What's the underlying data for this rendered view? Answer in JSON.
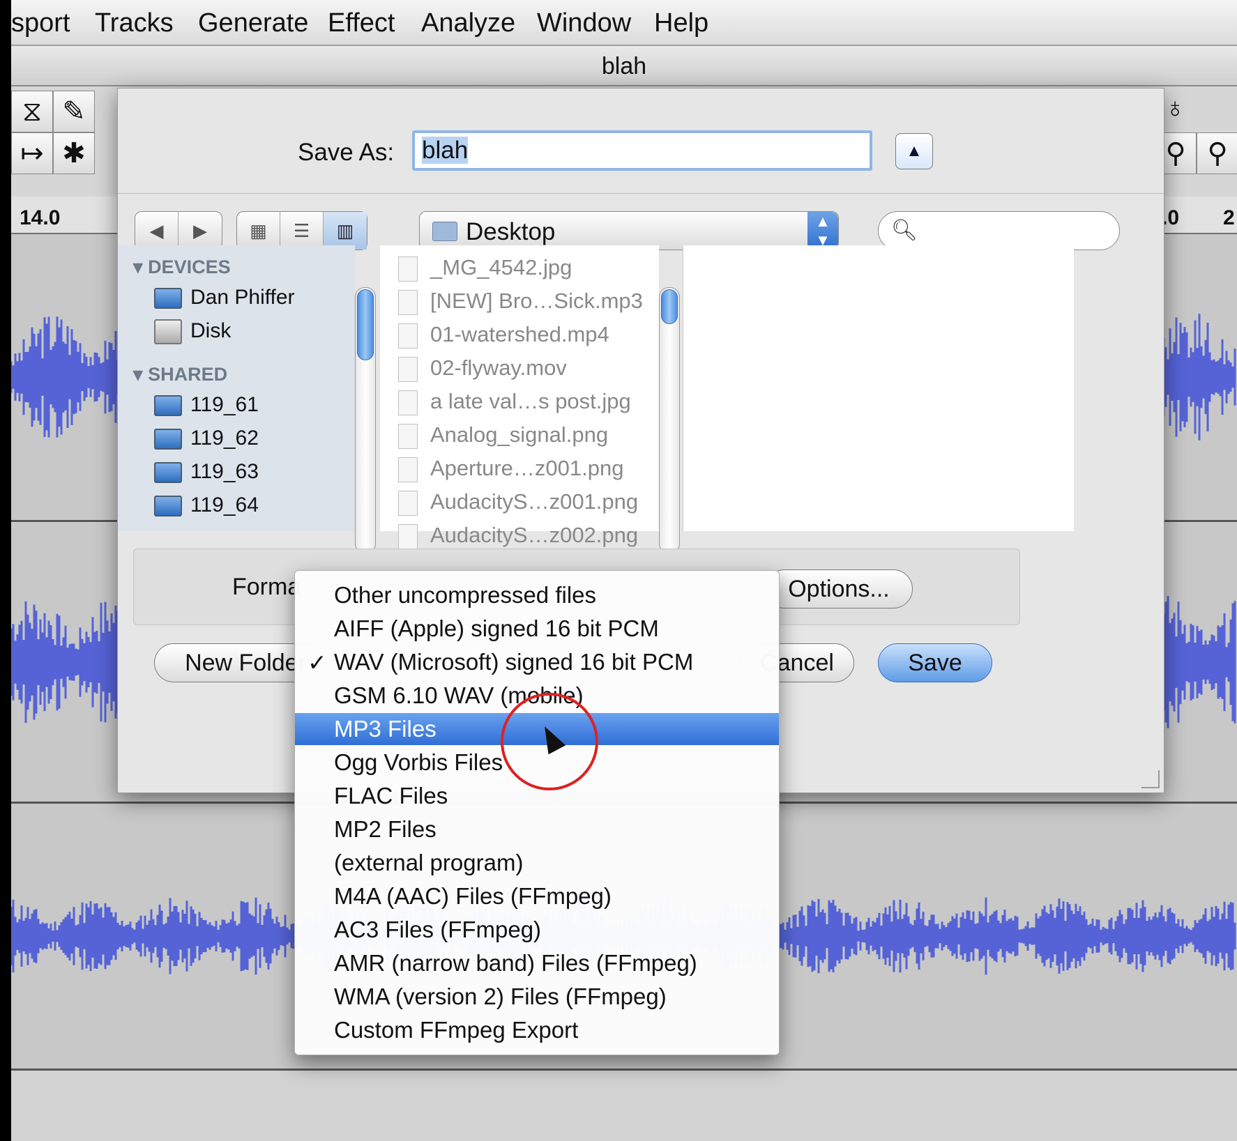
{
  "menubar": {
    "items": [
      "sport",
      "Tracks",
      "Generate",
      "Effect",
      "Analyze",
      "Window",
      "Help"
    ]
  },
  "window": {
    "title": "blah"
  },
  "ruler": {
    "left_tick": "14.0",
    "right_tick_a": ".0",
    "right_tick_b": "2"
  },
  "dialog": {
    "save_as_label": "Save As:",
    "save_as_value": "blah",
    "location": "Desktop",
    "sidebar": {
      "devices_header": "DEVICES",
      "devices": [
        "Dan Phiffer",
        "Disk"
      ],
      "shared_header": "SHARED",
      "shared": [
        "119_61",
        "119_62",
        "119_63",
        "119_64"
      ]
    },
    "files": [
      "_MG_4542.jpg",
      "[NEW] Bro…Sick.mp3",
      "01-watershed.mp4",
      "02-flyway.mov",
      "a late val…s post.jpg",
      "Analog_signal.png",
      "Aperture…z001.png",
      "AudacityS…z001.png",
      "AudacityS…z002.png"
    ],
    "format_label": "Forma",
    "options_label": "Options...",
    "new_folder_label": "New Folder",
    "cancel_label": "Cancel",
    "save_label": "Save"
  },
  "format_menu": {
    "checked_index": 2,
    "highlighted_index": 4,
    "check_glyph": "✓",
    "options": [
      "Other uncompressed files",
      "AIFF (Apple) signed 16 bit PCM",
      "WAV (Microsoft) signed 16 bit PCM",
      "GSM 6.10 WAV (mobile)",
      "MP3 Files",
      "Ogg Vorbis Files",
      "FLAC Files",
      "MP2 Files",
      "(external program)",
      "M4A (AAC) Files (FFmpeg)",
      "AC3 Files (FFmpeg)",
      "AMR (narrow band) Files (FFmpeg)",
      "WMA (version 2) Files (FFmpeg)",
      "Custom FFmpeg Export"
    ]
  },
  "colors": {
    "accent": "#2f6ed6",
    "waveform": "#5563d6",
    "annotation": "#dd2222"
  }
}
